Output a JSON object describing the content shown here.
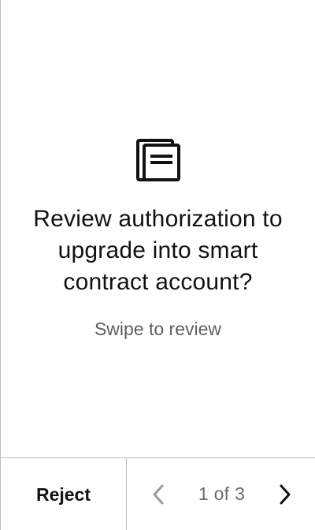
{
  "review": {
    "icon": "document-icon",
    "title": "Review authorization to upgrade into smart contract account?",
    "subtitle": "Swipe to review"
  },
  "footer": {
    "reject_label": "Reject",
    "page_label": "1 of 3",
    "prev_icon": "chevron-left-icon",
    "next_icon": "chevron-right-icon",
    "current_page": 1,
    "total_pages": 3
  },
  "colors": {
    "text": "#111111",
    "muted": "#5f5f5f",
    "divider": "#bdbdbd",
    "disabled_icon": "#9a9a9a"
  }
}
